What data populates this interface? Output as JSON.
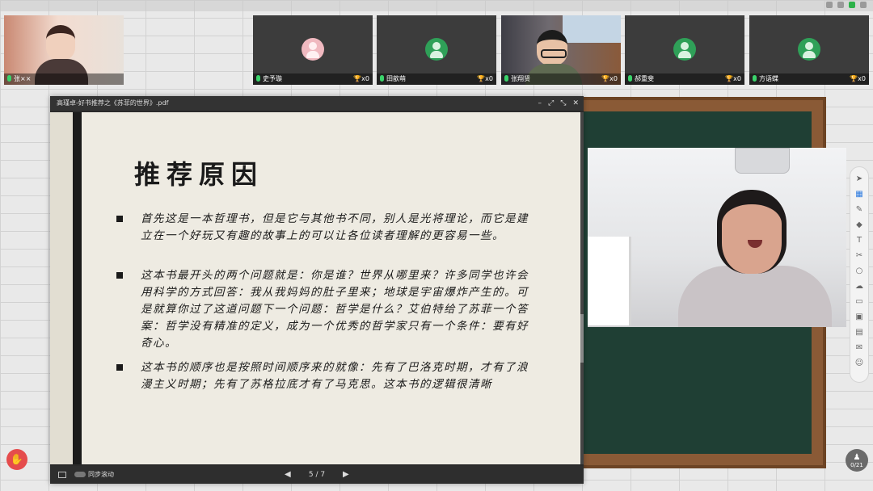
{
  "participants": [
    {
      "name": "张××",
      "trophies": "",
      "has_video": true
    },
    {
      "name": "史予璇",
      "trophies": "x0",
      "has_video": false
    },
    {
      "name": "田歆萌",
      "trophies": "x0",
      "has_video": false
    },
    {
      "name": "张翔贤",
      "trophies": "x0",
      "has_video": true
    },
    {
      "name": "郝重斐",
      "trophies": "x0",
      "has_video": false
    },
    {
      "name": "方语蝶",
      "trophies": "x0",
      "has_video": false
    }
  ],
  "pdf": {
    "title": "高瑾卓-好书推荐之《苏菲的世界》.pdf",
    "slide_title": "推荐原因",
    "bullets": [
      "首先这是一本哲理书，但是它与其他书不同，别人是光将理论，而它是建立在一个好玩又有趣的故事上的可以让各位读者理解的更容易一些。",
      "这本书最开头的两个问题就是：你是谁？世界从哪里来？许多同学也许会用科学的方式回答：我从我妈妈的肚子里来；地球是宇宙爆炸产生的。可是就算你过了这道问题下一个问题：哲学是什么？艾伯特给了苏菲一个答案：哲学没有精准的定义，成为一个优秀的哲学家只有一个条件：要有好奇心。",
      "这本书的顺序也是按照时间顺序来的就像：先有了巴洛克时期，才有了浪漫主义时期；先有了苏格拉底才有了马克思。这本书的逻辑很清晰"
    ],
    "sync_label": "同步滚动",
    "page_indicator": "5 / 7",
    "controls": {
      "minimize": "–",
      "restore": "⤢",
      "expand": "⤡",
      "close": "✕"
    }
  },
  "counter": {
    "value": "0/21"
  },
  "colors": {
    "accent_green": "#2fa058",
    "blackboard": "#1f3f34",
    "frame_wood": "#8a5a36",
    "hand_red": "#e54c4c"
  },
  "icons": {
    "toolbar": [
      "pointer-icon",
      "grid-icon",
      "pen-icon",
      "eraser-icon",
      "text-icon",
      "crop-icon",
      "shape-icon",
      "cloud-icon",
      "ruler-icon",
      "save-icon",
      "note-icon",
      "chat-icon",
      "user-icon"
    ]
  }
}
